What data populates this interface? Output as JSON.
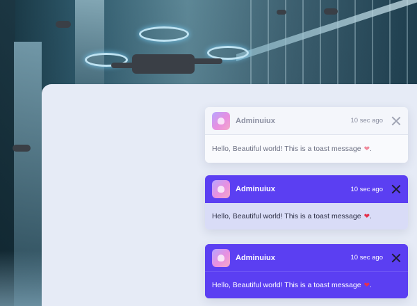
{
  "toasts": [
    {
      "variant": "light",
      "app_name": "Adminuiux",
      "time": "10 sec ago",
      "message": "Hello, Beautiful world! This is a toast message",
      "suffix": ".",
      "icon": "heart-icon"
    },
    {
      "variant": "primary-header",
      "app_name": "Adminuiux",
      "time": "10 sec ago",
      "message": "Hello, Beautiful world! This is a toast message",
      "suffix": ".",
      "icon": "heart-icon"
    },
    {
      "variant": "primary",
      "app_name": "Adminuiux",
      "time": "10 sec ago",
      "message": "Hello, Beautiful world! This is a toast message",
      "suffix": ".",
      "icon": "heart-icon"
    }
  ],
  "colors": {
    "primary": "#5b3ff2",
    "panel_bg": "#e6ebf6",
    "heart": "#e5304d"
  }
}
